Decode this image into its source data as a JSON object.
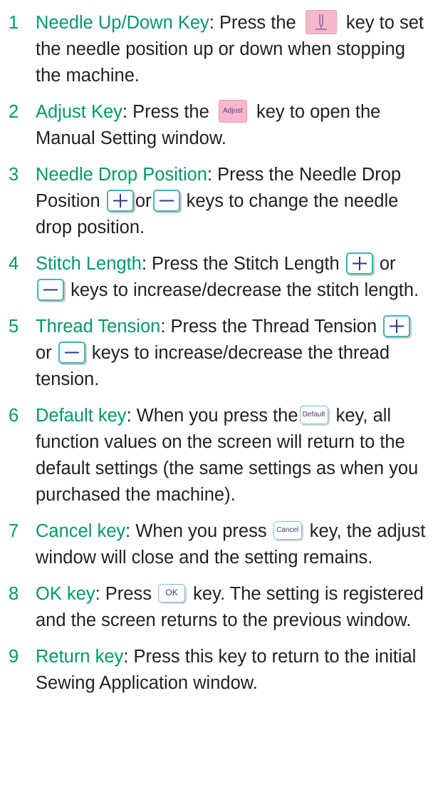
{
  "items": [
    {
      "num": "1",
      "term": "Needle Up/Down Key",
      "t1": ": Press the",
      "t2": "key to set the needle position up or down when stopping the machine."
    },
    {
      "num": "2",
      "term": "Adjust Key",
      "t1": ": Press the",
      "key": "Adjust",
      "t2": "key to open the Manual Setting window."
    },
    {
      "num": "3",
      "term": "Needle Drop Position",
      "t1": ": Press the Needle Drop Position",
      "t2": "or",
      "t3": "keys to change the needle drop position."
    },
    {
      "num": "4",
      "term": "Stitch Length",
      "t1": ": Press the Stitch Length",
      "t2": "or",
      "t3": "keys to increase/decrease the stitch length."
    },
    {
      "num": "5",
      "term": "Thread Tension",
      "t1": ": Press the Thread Tension",
      "t2": "or",
      "t3": "keys to increase/decrease the thread tension."
    },
    {
      "num": "6",
      "term": "Default key",
      "t1": ": When you press the",
      "key": "Default",
      "t2": "key, all function values on the screen will return to the default settings (the same settings as when you purchased the machine)."
    },
    {
      "num": "7",
      "term": "Cancel key",
      "t1": ": When you press",
      "key": "Cancel",
      "t2": "key, the adjust window will close and the setting remains."
    },
    {
      "num": "8",
      "term": "OK key",
      "t1": ": Press",
      "key": "OK",
      "t2": "key. The setting is registered and the screen returns to the previous window."
    },
    {
      "num": "9",
      "term": "Return key",
      "t1": ": Press this key to return to the initial Sewing Application window."
    }
  ],
  "icons": {
    "needle_key": "needle-up-down-icon",
    "plus_key": "plus-icon",
    "minus_key": "minus-icon"
  },
  "colors": {
    "term": "#009a66",
    "text": "#231f20",
    "pink_key": "#f6b8cc",
    "teal_border": "#3fb6b0"
  }
}
